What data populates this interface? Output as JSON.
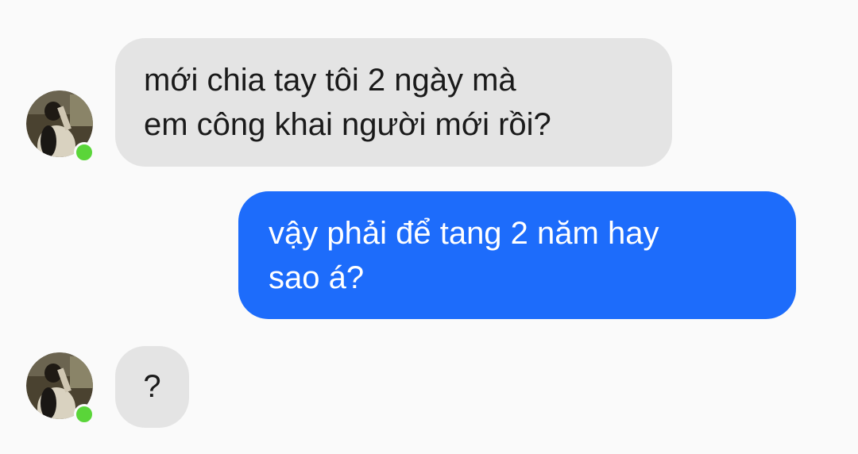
{
  "conversation": {
    "messages": [
      {
        "sender": "contact",
        "lines": [
          "mới chia tay tôi 2 ngày mà",
          "em công khai người mới rồi?"
        ]
      },
      {
        "sender": "me",
        "lines": [
          "vậy phải để tang 2 năm hay",
          "sao á?"
        ]
      },
      {
        "sender": "contact",
        "lines": [
          "?"
        ]
      }
    ]
  },
  "contact": {
    "status": "online",
    "status_color": "#5ad539"
  },
  "colors": {
    "background": "#fafafa",
    "incoming_bubble": "#e4e4e4",
    "outgoing_bubble": "#1d6cfb",
    "incoming_text": "#1a1a1a",
    "outgoing_text": "#ffffff"
  }
}
